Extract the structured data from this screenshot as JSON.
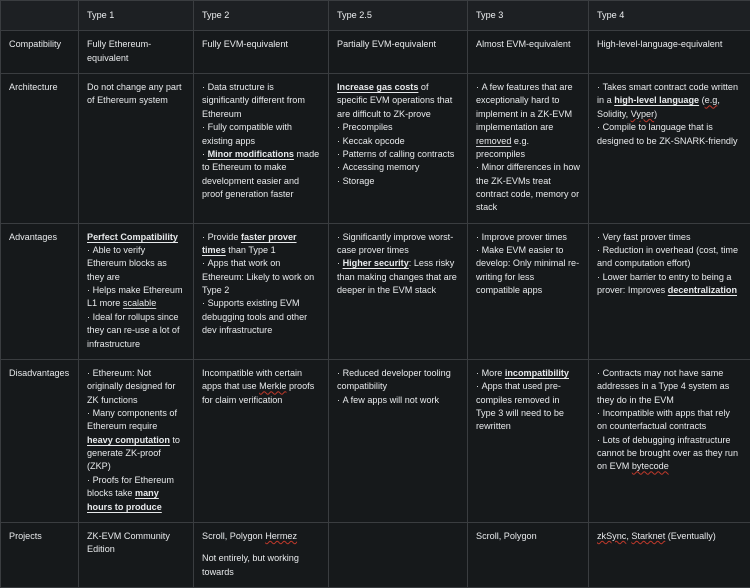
{
  "table": {
    "columns": [
      {
        "id": "label",
        "header": ""
      },
      {
        "id": "type1",
        "header": "Type 1"
      },
      {
        "id": "type2",
        "header": "Type 2"
      },
      {
        "id": "type25",
        "header": "Type 2.5"
      },
      {
        "id": "type3",
        "header": "Type 3"
      },
      {
        "id": "type4",
        "header": "Type 4"
      }
    ],
    "rows": {
      "compatibility": {
        "label": "Compatibility",
        "type1": "Fully Ethereum-equivalent",
        "type2": "Fully EVM-equivalent",
        "type25": "Partially EVM-equivalent",
        "type3": "Almost EVM-equivalent",
        "type4": "High-level-language-equivalent"
      },
      "architecture": {
        "label": "Architecture",
        "type1_l1": "Do not change any part of Ethereum system",
        "type2_b1": "Data structure is significantly different from Ethereum",
        "type2_b2": "Fully compatible with existing apps",
        "type2_b3a": "Minor modifications",
        "type2_b3b": " made to Ethereum to make development easier and proof generation faster",
        "type25_h1": "Increase gas costs",
        "type25_h2": " of specific EVM operations that are difficult to ZK-prove",
        "type25_b1": "Precompiles",
        "type25_b2": "Keccak opcode",
        "type25_b3": "Patterns of calling contracts",
        "type25_b4": "Accessing memory",
        "type25_b5": "Storage",
        "type3_b1a": "A few features that are exceptionally hard to implement in a ZK-EVM implementation are ",
        "type3_b1b": "removed",
        "type3_b1c": " e.g. precompiles",
        "type3_b2": "Minor differences in how the ZK-EVMs treat contract code, memory or stack",
        "type4_b1a": "Takes smart contract code written in a ",
        "type4_b1b": "high-level language",
        "type4_b1c": " (",
        "type4_b1d": "e.g",
        "type4_b1e": ", Solidity, ",
        "type4_b1f": "Vyper",
        "type4_b1g": ")",
        "type4_b2": "Compile to language that is designed to be ZK-SNARK-friendly"
      },
      "advantages": {
        "label": "Advantages",
        "type1_h": "Perfect Compatibility",
        "type1_b1": "Able to verify Ethereum blocks as they are",
        "type1_b2a": "Helps make Ethereum L1 more ",
        "type1_b2b": "scalable",
        "type1_b3": "Ideal for rollups since they can re-use a lot of infrastructure",
        "type2_b1a": "Provide ",
        "type2_b1b": "faster prover times",
        "type2_b1c": " than Type 1",
        "type2_b2": "Apps that work on Ethereum: Likely to work on Type 2",
        "type2_b3": "Supports existing EVM debugging tools and other dev infrastructure",
        "type25_b1": "Significantly improve worst-case prover times",
        "type25_b2a": "Higher security",
        "type25_b2b": ": Less risky than making changes that are deeper in the EVM stack",
        "type3_b1": "Improve prover times",
        "type3_b2": "Make EVM easier to develop: Only minimal re-writing for less compatible apps",
        "type4_b1": "Very fast prover times",
        "type4_b2": "Reduction in overhead (cost, time and computation effort)",
        "type4_b3a": "Lower barrier to entry to being a prover: Improves ",
        "type4_b3b": "decentralization"
      },
      "disadvantages": {
        "label": "Disadvantages",
        "type1_b1": "Ethereum: Not originally designed for ZK functions",
        "type1_b2a": "Many components of Ethereum require ",
        "type1_b2b": "heavy computation",
        "type1_b2c": " to generate ZK-proof (ZKP)",
        "type1_b3a": "Proofs for Ethereum blocks take ",
        "type1_b3b": "many hours to produce",
        "type2_l1a": "Incompatible with certain apps that use ",
        "type2_l1b": "Merkle",
        "type2_l1c": " proofs for claim verification",
        "type25_b1": "Reduced developer tooling compatibility",
        "type25_b2": "A few apps will not work",
        "type3_b1a": "More ",
        "type3_b1b": "incompatibility",
        "type3_b2": "Apps that used pre-compiles removed in Type 3 will need to be rewritten",
        "type4_b1": "Contracts may not have same addresses in a Type 4 system as they do in the EVM",
        "type4_b2": "Incompatible with apps that rely on counterfactual contracts",
        "type4_b3a": "Lots of debugging infrastructure cannot be brought over as they run on EVM ",
        "type4_b3b": "bytecode"
      },
      "projects": {
        "label": "Projects",
        "type1": "ZK-EVM Community Edition",
        "type2_l1a": "Scroll, Polygon ",
        "type2_l1b": "Hermez",
        "type2_l2": "Not entirely, but working towards",
        "type25": "",
        "type3": "Scroll, Polygon",
        "type4_a": "zkSync",
        "type4_b": ", ",
        "type4_c": "Starknet",
        "type4_d": " (Eventually)"
      }
    }
  }
}
